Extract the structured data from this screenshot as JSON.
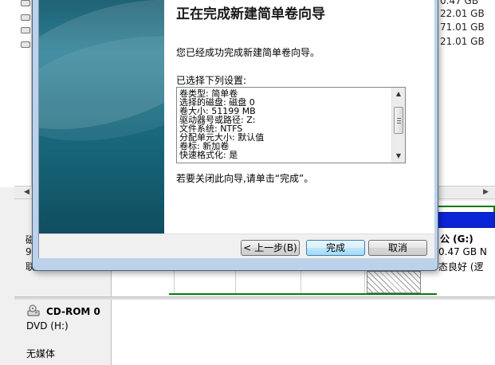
{
  "background": {
    "capacity_column": [
      "0.47 GB",
      "22.01 GB",
      "71.01 GB",
      "21.01 GB"
    ],
    "left_truncated": [
      "磁",
      "9",
      "联"
    ],
    "partition_g": {
      "name": "公  (G:)",
      "size": "0.47 GB N",
      "status": "态良好 (逻"
    },
    "cdrom": {
      "title": "CD-ROM 0",
      "drive": "DVD (H:)",
      "media": "无媒体"
    },
    "accent_blue": "#0a24d8",
    "partition_frame_green": "#0b7a0b"
  },
  "wizard": {
    "title": "正在完成新建简单卷向导",
    "intro": "您已经成功完成新建简单卷向导。",
    "settings_label": "已选择下列设置:",
    "settings": [
      "卷类型: 简单卷",
      "选择的磁盘: 磁盘 0",
      "卷大小: 51199 MB",
      "驱动器号或路径: Z:",
      "文件系统: NTFS",
      "分配单元大小: 默认值",
      "卷标: 新加卷",
      "快速格式化: 是"
    ],
    "finish_note": "若要关闭此向导,请单击“完成”。",
    "buttons": {
      "back": "< 上一步(B)",
      "finish": "完成",
      "cancel": "取消"
    },
    "side_panel_color": "#1d6a80"
  }
}
